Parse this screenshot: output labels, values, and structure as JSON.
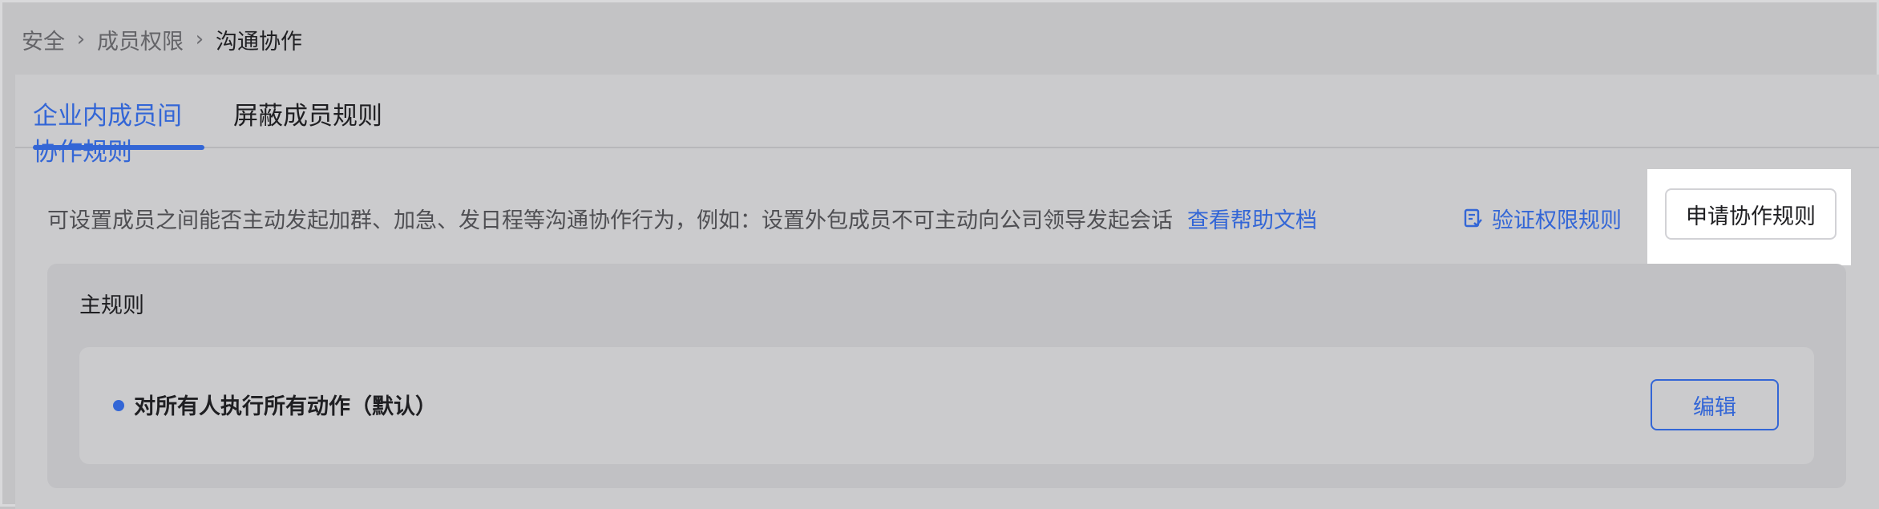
{
  "breadcrumb": {
    "items": [
      "安全",
      "成员权限",
      "沟通协作"
    ]
  },
  "tabs": [
    {
      "label": "企业内成员间协作规则",
      "active": true
    },
    {
      "label": "屏蔽成员规则",
      "active": false
    }
  ],
  "description": {
    "text": "可设置成员之间能否主动发起加群、加急、发日程等沟通协作行为，例如：设置外包成员不可主动向公司领导发起会话",
    "help_link": "查看帮助文档"
  },
  "actions": {
    "verify_label": "验证权限规则",
    "apply_label": "申请协作规则"
  },
  "main_rule": {
    "title": "主规则",
    "item_label": "对所有人执行所有动作（默认）",
    "edit_label": "编辑"
  },
  "colors": {
    "accent": "#3366d6",
    "background": "#c3c3c5"
  },
  "icons": {
    "verify": "document-check-icon",
    "breadcrumb_separator": "chevron-right-icon"
  }
}
